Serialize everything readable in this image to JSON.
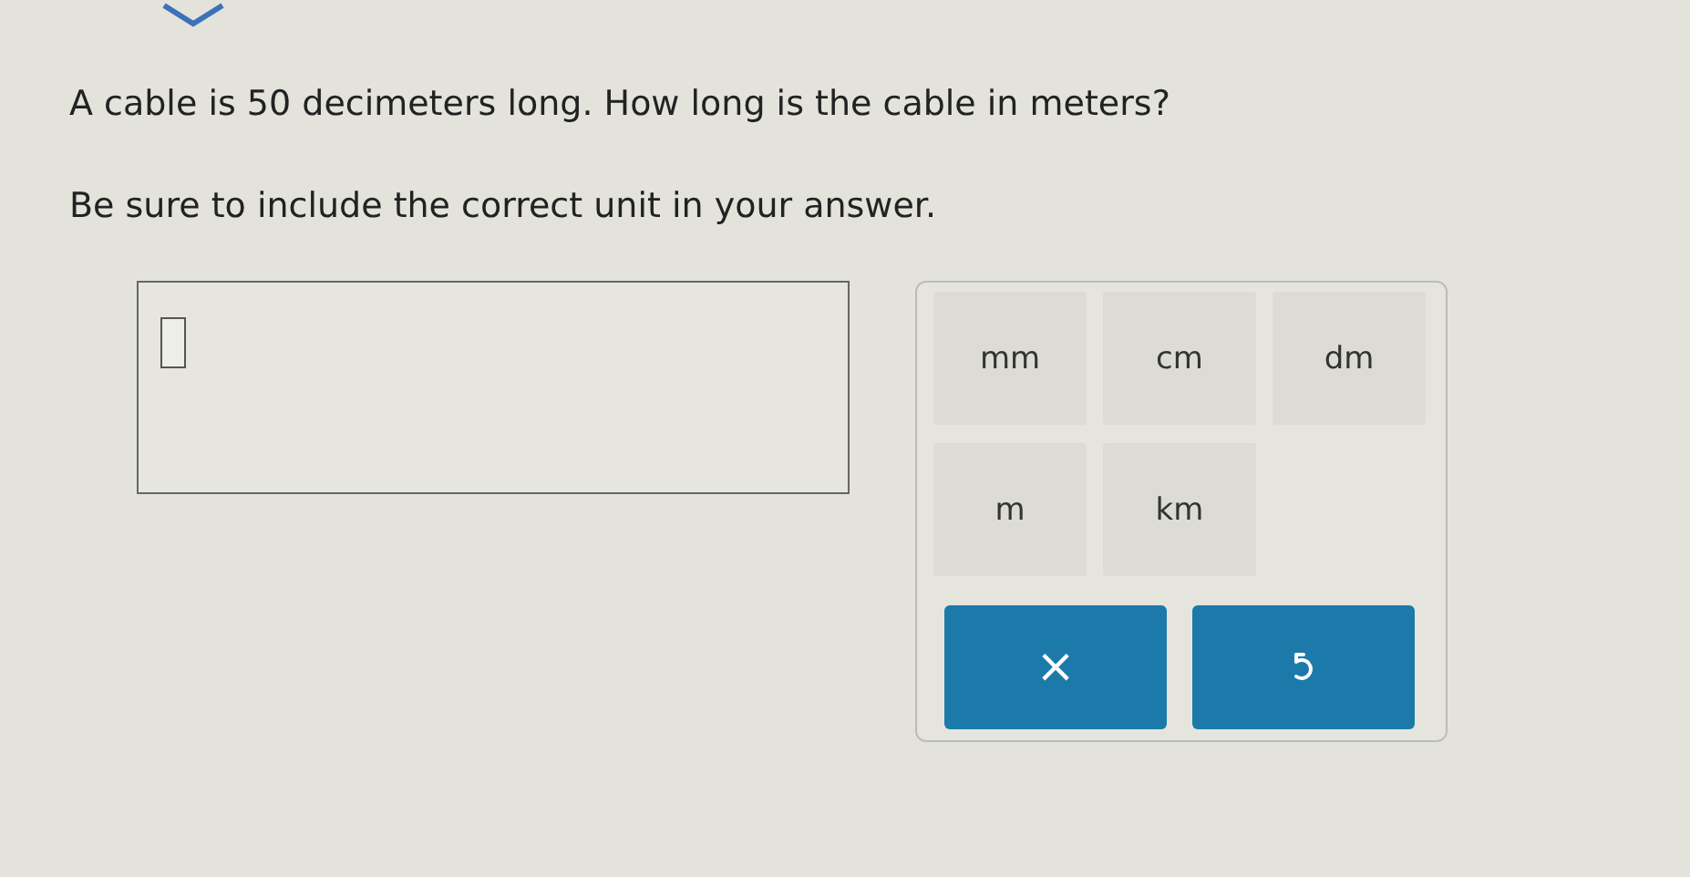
{
  "question": {
    "lines": [
      "A cable is 50 decimeters long. How long is the cable in meters?",
      "Be sure to include the correct unit in your answer."
    ]
  },
  "answer": {
    "slots": [
      {
        "kind": "blank"
      }
    ]
  },
  "keypad": {
    "units": [
      {
        "label": "mm"
      },
      {
        "label": "cm"
      },
      {
        "label": "dm"
      },
      {
        "label": "m"
      },
      {
        "label": "km"
      }
    ],
    "actions": [
      {
        "kind": "clear",
        "label": "×"
      },
      {
        "kind": "undo"
      }
    ]
  }
}
